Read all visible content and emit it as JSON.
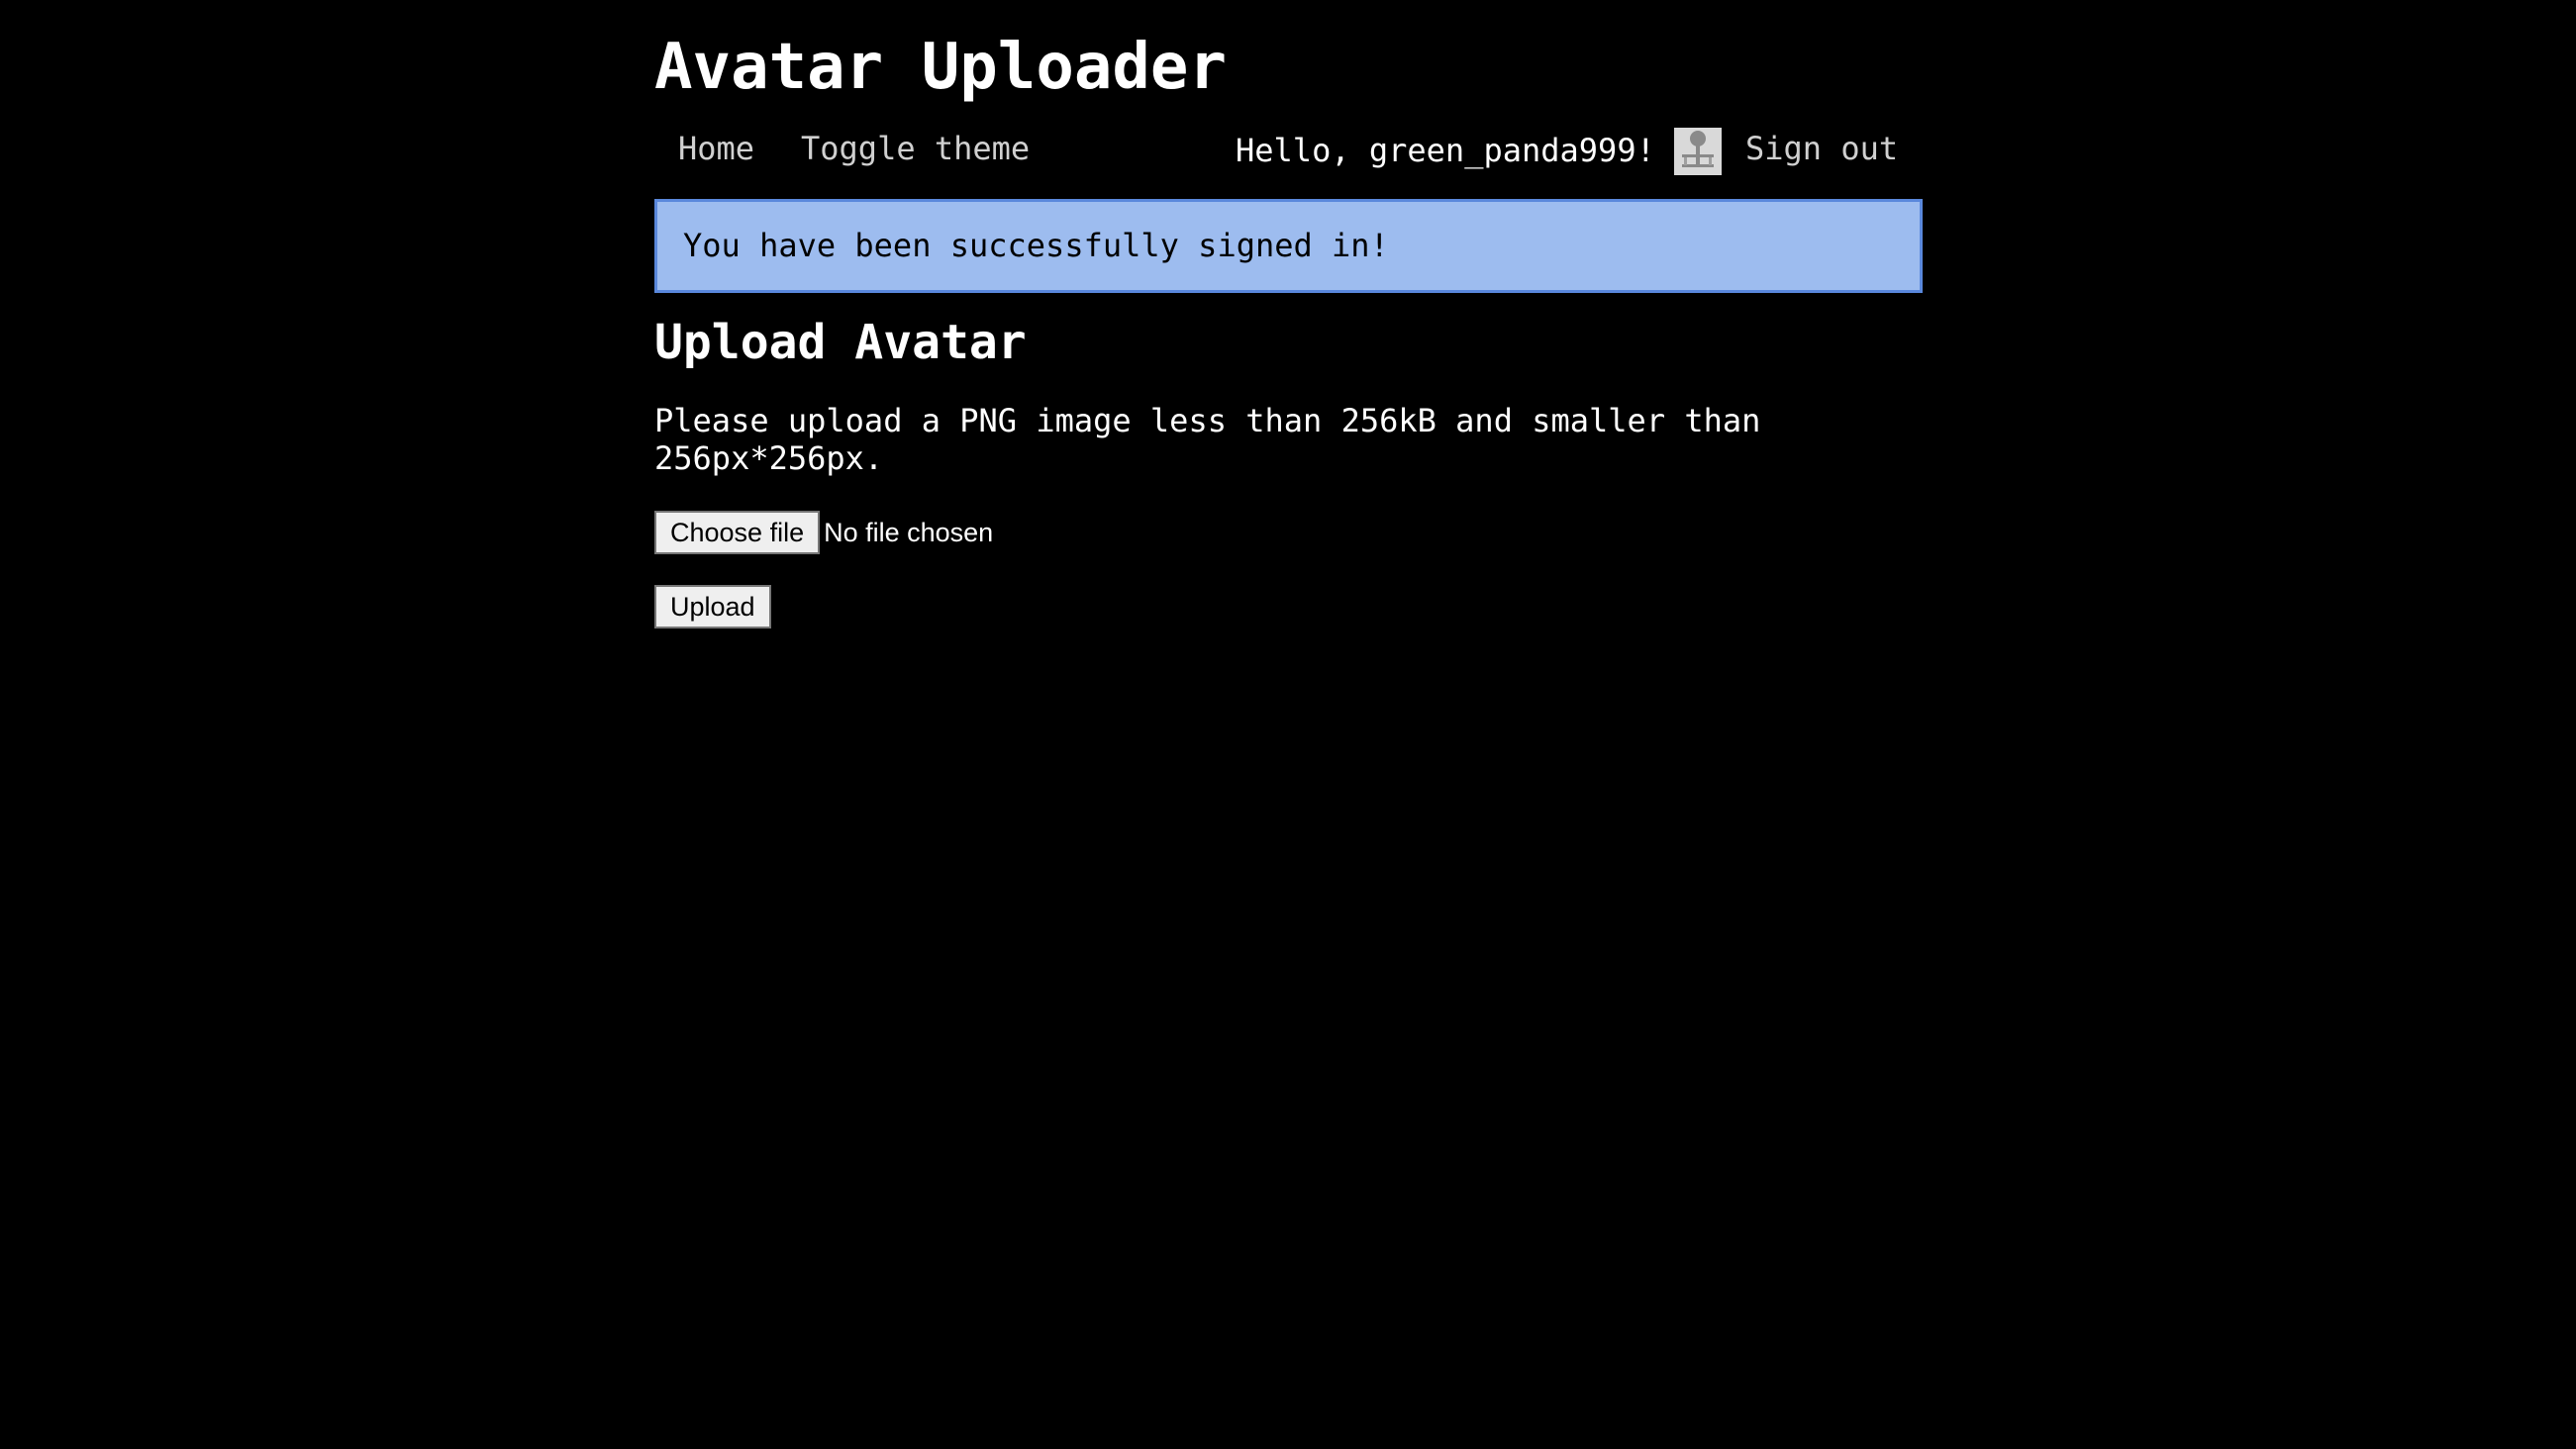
{
  "site": {
    "title": "Avatar Uploader"
  },
  "nav": {
    "home": "Home",
    "toggle_theme": "Toggle theme",
    "greeting": "Hello, green_panda999!",
    "avatar_icon": "default-avatar-icon",
    "sign_out": "Sign out"
  },
  "flash": {
    "message": "You have been successfully signed in!",
    "background_color": "#9dbcef",
    "border_color": "#5a88dc"
  },
  "main": {
    "heading": "Upload Avatar",
    "instructions": "Please upload a PNG image less than 256kB and smaller than 256px*256px.",
    "file_input": {
      "button_label": "Choose file",
      "status": "No file chosen"
    },
    "upload_button": "Upload"
  },
  "colors": {
    "background": "#000000",
    "text": "#ffffff",
    "nav_link": "#d0d0d0"
  }
}
